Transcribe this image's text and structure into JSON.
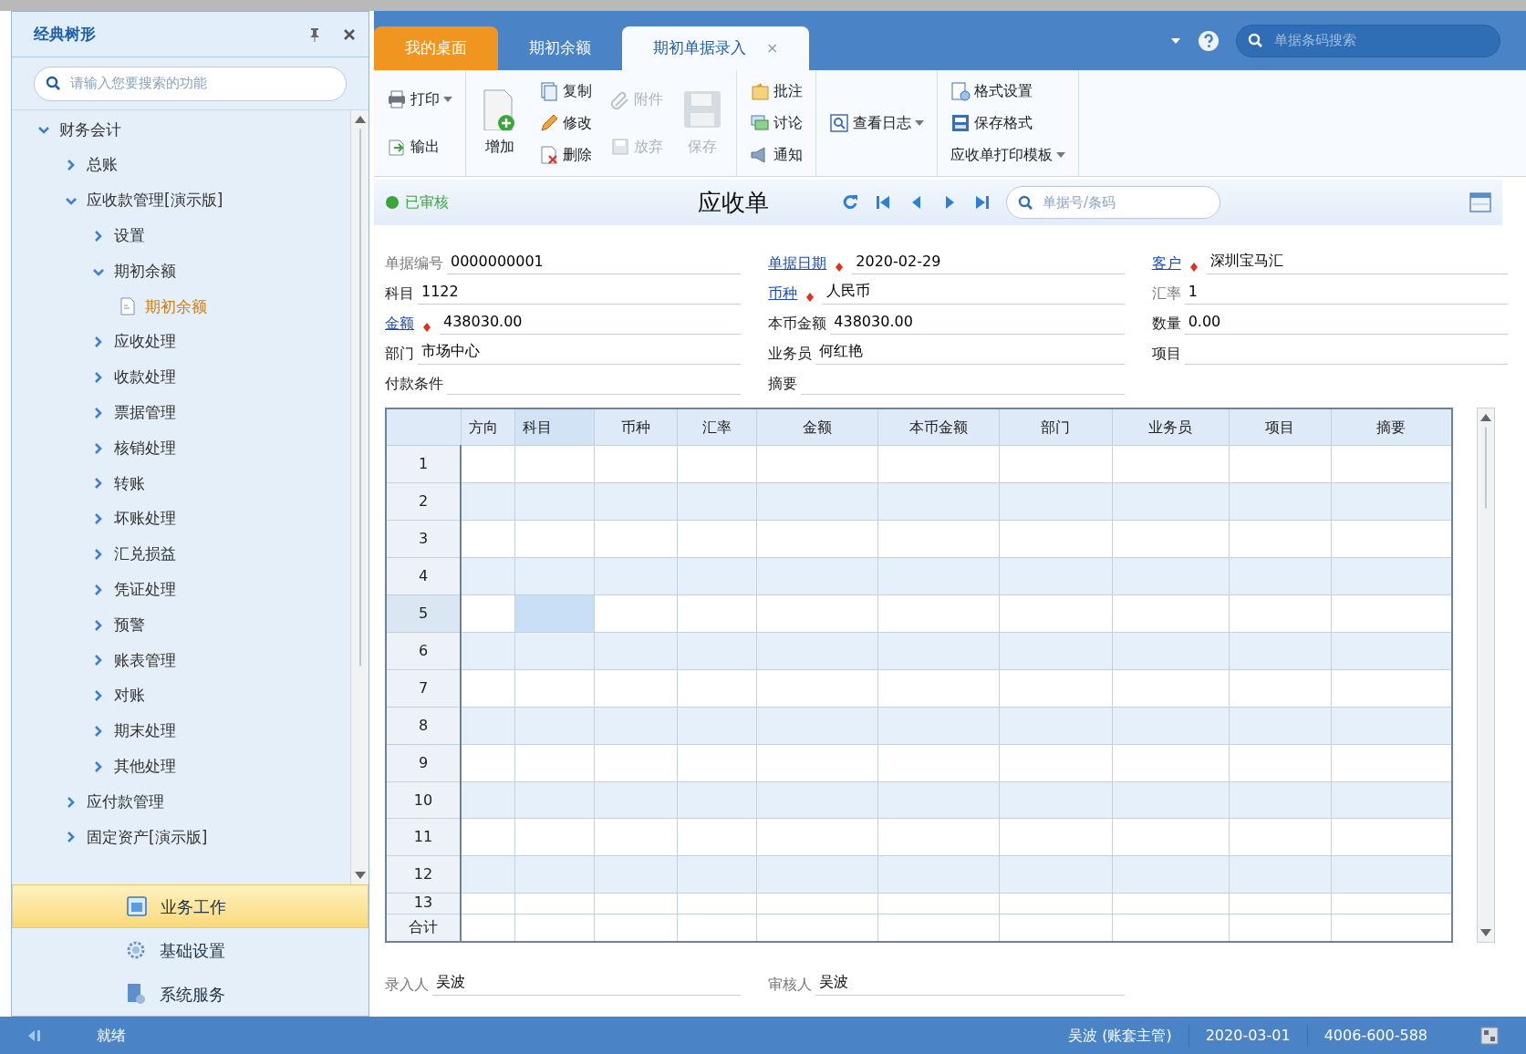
{
  "sidebar": {
    "title": "经典树形",
    "search": {
      "placeholder": "请输入您要搜索的功能"
    },
    "tree": [
      {
        "label": "财务会计",
        "expanded": true,
        "children": [
          {
            "label": "总账",
            "expanded": false
          },
          {
            "label": "应收款管理[演示版]",
            "expanded": true,
            "children": [
              {
                "label": "设置",
                "expanded": false
              },
              {
                "label": "期初余额",
                "expanded": true,
                "children": [
                  {
                    "label": "期初余额",
                    "kind": "leaf",
                    "selected": true
                  }
                ]
              },
              {
                "label": "应收处理",
                "expanded": false
              },
              {
                "label": "收款处理",
                "expanded": false
              },
              {
                "label": "票据管理",
                "expanded": false
              },
              {
                "label": "核销处理",
                "expanded": false
              },
              {
                "label": "转账",
                "expanded": false
              },
              {
                "label": "坏账处理",
                "expanded": false
              },
              {
                "label": "汇兑损益",
                "expanded": false
              },
              {
                "label": "凭证处理",
                "expanded": false
              },
              {
                "label": "预警",
                "expanded": false
              },
              {
                "label": "账表管理",
                "expanded": false
              },
              {
                "label": "对账",
                "expanded": false
              },
              {
                "label": "期末处理",
                "expanded": false
              },
              {
                "label": "其他处理",
                "expanded": false
              }
            ]
          },
          {
            "label": "应付款管理",
            "expanded": false
          },
          {
            "label": "固定资产[演示版]",
            "expanded": false
          }
        ]
      }
    ],
    "nav": [
      {
        "label": "业务工作",
        "selected": true
      },
      {
        "label": "基础设置",
        "selected": false
      },
      {
        "label": "系统服务",
        "selected": false
      }
    ]
  },
  "tabs": [
    {
      "label": "我的桌面",
      "kind": "home",
      "selected": false,
      "closable": false
    },
    {
      "label": "期初余额",
      "kind": "normal",
      "selected": false,
      "closable": false
    },
    {
      "label": "期初单据录入",
      "kind": "normal",
      "selected": true,
      "closable": true,
      "close": "×"
    }
  ],
  "top_search": {
    "placeholder": "单据条码搜索"
  },
  "toolbar": [
    [
      [
        {
          "label": "打印",
          "kind": "small",
          "disabled": false,
          "dropdown": true
        },
        {
          "label": "输出",
          "kind": "small",
          "disabled": false,
          "dropdown": false
        }
      ]
    ],
    [
      [
        {
          "label": "增加",
          "kind": "large",
          "disabled": false,
          "dropdown": false
        }
      ],
      [
        {
          "label": "复制",
          "kind": "small",
          "disabled": false,
          "dropdown": false
        },
        {
          "label": "修改",
          "kind": "small",
          "disabled": false,
          "dropdown": false
        },
        {
          "label": "删除",
          "kind": "small",
          "disabled": false,
          "dropdown": false
        }
      ],
      [
        {
          "label": "附件",
          "kind": "small",
          "disabled": true,
          "dropdown": false
        },
        {
          "label": "放弃",
          "kind": "small",
          "disabled": true,
          "dropdown": false
        }
      ],
      [
        {
          "label": "保存",
          "kind": "large",
          "disabled": true,
          "dropdown": false
        }
      ]
    ],
    [
      [
        {
          "label": "批注",
          "kind": "small",
          "disabled": false,
          "dropdown": false
        },
        {
          "label": "讨论",
          "kind": "small",
          "disabled": false,
          "dropdown": false
        },
        {
          "label": "通知",
          "kind": "small",
          "disabled": false,
          "dropdown": false
        }
      ]
    ],
    [
      [
        {
          "label": "查看日志",
          "kind": "small",
          "disabled": false,
          "dropdown": true
        }
      ]
    ],
    [
      [
        {
          "label": "格式设置",
          "kind": "small",
          "disabled": false,
          "dropdown": false
        },
        {
          "label": "保存格式",
          "kind": "small",
          "disabled": false,
          "dropdown": false
        },
        {
          "label": "应收单打印模板",
          "kind": "plain",
          "disabled": false,
          "dropdown": true
        }
      ]
    ]
  ],
  "document": {
    "status": "已审核",
    "title": "应收单",
    "search": {
      "placeholder": "单据号/条码"
    },
    "fields": [
      {
        "label": "单据编号",
        "kind": "muted",
        "required": false,
        "value": "0000000001"
      },
      {
        "label": "单据日期",
        "kind": "link",
        "required": true,
        "value": "2020-02-29"
      },
      {
        "label": "客户",
        "kind": "link",
        "required": true,
        "value": "深圳宝马汇"
      },
      {
        "label": "科目",
        "kind": "normal",
        "required": false,
        "value": "1122"
      },
      {
        "label": "币种",
        "kind": "link",
        "required": true,
        "value": "人民币"
      },
      {
        "label": "汇率",
        "kind": "muted",
        "required": false,
        "value": "1"
      },
      {
        "label": "金额",
        "kind": "link",
        "required": true,
        "value": "438030.00"
      },
      {
        "label": "本币金额",
        "kind": "normal",
        "required": false,
        "value": "438030.00"
      },
      {
        "label": "数量",
        "kind": "normal",
        "required": false,
        "value": "0.00"
      },
      {
        "label": "部门",
        "kind": "normal",
        "required": false,
        "value": "市场中心"
      },
      {
        "label": "业务员",
        "kind": "normal",
        "required": false,
        "value": "何红艳"
      },
      {
        "label": "项目",
        "kind": "normal",
        "required": false
      },
      {
        "label": "付款条件",
        "kind": "normal",
        "required": false
      },
      {
        "label": "摘要",
        "kind": "normal",
        "required": false
      }
    ],
    "grid": {
      "columns": [
        {
          "label": "方向",
          "selected": false
        },
        {
          "label": "科目",
          "selected": true
        },
        {
          "label": "币种",
          "selected": false
        },
        {
          "label": "汇率",
          "selected": false
        },
        {
          "label": "金额",
          "selected": false
        },
        {
          "label": "本币金额",
          "selected": false
        },
        {
          "label": "部门",
          "selected": false
        },
        {
          "label": "业务员",
          "selected": false
        },
        {
          "label": "项目",
          "selected": false
        },
        {
          "label": "摘要",
          "selected": false
        }
      ],
      "rows": [
        {
          "label": "1",
          "selected": false
        },
        {
          "label": "2",
          "selected": false
        },
        {
          "label": "3",
          "selected": false
        },
        {
          "label": "4",
          "selected": false
        },
        {
          "label": "5",
          "selected": true
        },
        {
          "label": "6",
          "selected": false
        },
        {
          "label": "7",
          "selected": false
        },
        {
          "label": "8",
          "selected": false
        },
        {
          "label": "9",
          "selected": false
        },
        {
          "label": "10",
          "selected": false
        },
        {
          "label": "11",
          "selected": false
        },
        {
          "label": "12",
          "selected": false
        },
        {
          "label": "13",
          "selected": false
        }
      ],
      "total_label": "合计"
    },
    "footer": [
      {
        "label": "录入人",
        "kind": "muted",
        "value": "吴波"
      },
      {
        "label": "审核人",
        "kind": "muted",
        "value": "吴波"
      }
    ]
  },
  "status_bar": {
    "message": "就绪",
    "user": "吴波 (账套主管)",
    "date": "2020-03-01",
    "phone": "4006-600-588"
  }
}
